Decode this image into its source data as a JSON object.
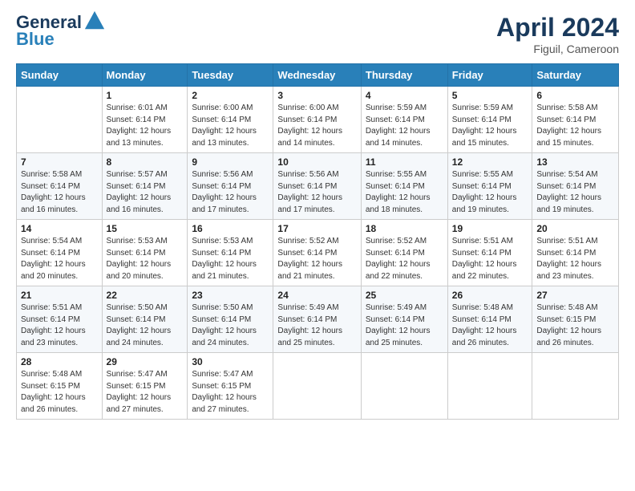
{
  "header": {
    "logo_line1": "General",
    "logo_line2": "Blue",
    "month": "April 2024",
    "location": "Figuil, Cameroon"
  },
  "weekdays": [
    "Sunday",
    "Monday",
    "Tuesday",
    "Wednesday",
    "Thursday",
    "Friday",
    "Saturday"
  ],
  "weeks": [
    [
      {
        "num": "",
        "info": ""
      },
      {
        "num": "1",
        "info": "Sunrise: 6:01 AM\nSunset: 6:14 PM\nDaylight: 12 hours\nand 13 minutes."
      },
      {
        "num": "2",
        "info": "Sunrise: 6:00 AM\nSunset: 6:14 PM\nDaylight: 12 hours\nand 13 minutes."
      },
      {
        "num": "3",
        "info": "Sunrise: 6:00 AM\nSunset: 6:14 PM\nDaylight: 12 hours\nand 14 minutes."
      },
      {
        "num": "4",
        "info": "Sunrise: 5:59 AM\nSunset: 6:14 PM\nDaylight: 12 hours\nand 14 minutes."
      },
      {
        "num": "5",
        "info": "Sunrise: 5:59 AM\nSunset: 6:14 PM\nDaylight: 12 hours\nand 15 minutes."
      },
      {
        "num": "6",
        "info": "Sunrise: 5:58 AM\nSunset: 6:14 PM\nDaylight: 12 hours\nand 15 minutes."
      }
    ],
    [
      {
        "num": "7",
        "info": "Sunrise: 5:58 AM\nSunset: 6:14 PM\nDaylight: 12 hours\nand 16 minutes."
      },
      {
        "num": "8",
        "info": "Sunrise: 5:57 AM\nSunset: 6:14 PM\nDaylight: 12 hours\nand 16 minutes."
      },
      {
        "num": "9",
        "info": "Sunrise: 5:56 AM\nSunset: 6:14 PM\nDaylight: 12 hours\nand 17 minutes."
      },
      {
        "num": "10",
        "info": "Sunrise: 5:56 AM\nSunset: 6:14 PM\nDaylight: 12 hours\nand 17 minutes."
      },
      {
        "num": "11",
        "info": "Sunrise: 5:55 AM\nSunset: 6:14 PM\nDaylight: 12 hours\nand 18 minutes."
      },
      {
        "num": "12",
        "info": "Sunrise: 5:55 AM\nSunset: 6:14 PM\nDaylight: 12 hours\nand 19 minutes."
      },
      {
        "num": "13",
        "info": "Sunrise: 5:54 AM\nSunset: 6:14 PM\nDaylight: 12 hours\nand 19 minutes."
      }
    ],
    [
      {
        "num": "14",
        "info": "Sunrise: 5:54 AM\nSunset: 6:14 PM\nDaylight: 12 hours\nand 20 minutes."
      },
      {
        "num": "15",
        "info": "Sunrise: 5:53 AM\nSunset: 6:14 PM\nDaylight: 12 hours\nand 20 minutes."
      },
      {
        "num": "16",
        "info": "Sunrise: 5:53 AM\nSunset: 6:14 PM\nDaylight: 12 hours\nand 21 minutes."
      },
      {
        "num": "17",
        "info": "Sunrise: 5:52 AM\nSunset: 6:14 PM\nDaylight: 12 hours\nand 21 minutes."
      },
      {
        "num": "18",
        "info": "Sunrise: 5:52 AM\nSunset: 6:14 PM\nDaylight: 12 hours\nand 22 minutes."
      },
      {
        "num": "19",
        "info": "Sunrise: 5:51 AM\nSunset: 6:14 PM\nDaylight: 12 hours\nand 22 minutes."
      },
      {
        "num": "20",
        "info": "Sunrise: 5:51 AM\nSunset: 6:14 PM\nDaylight: 12 hours\nand 23 minutes."
      }
    ],
    [
      {
        "num": "21",
        "info": "Sunrise: 5:51 AM\nSunset: 6:14 PM\nDaylight: 12 hours\nand 23 minutes."
      },
      {
        "num": "22",
        "info": "Sunrise: 5:50 AM\nSunset: 6:14 PM\nDaylight: 12 hours\nand 24 minutes."
      },
      {
        "num": "23",
        "info": "Sunrise: 5:50 AM\nSunset: 6:14 PM\nDaylight: 12 hours\nand 24 minutes."
      },
      {
        "num": "24",
        "info": "Sunrise: 5:49 AM\nSunset: 6:14 PM\nDaylight: 12 hours\nand 25 minutes."
      },
      {
        "num": "25",
        "info": "Sunrise: 5:49 AM\nSunset: 6:14 PM\nDaylight: 12 hours\nand 25 minutes."
      },
      {
        "num": "26",
        "info": "Sunrise: 5:48 AM\nSunset: 6:14 PM\nDaylight: 12 hours\nand 26 minutes."
      },
      {
        "num": "27",
        "info": "Sunrise: 5:48 AM\nSunset: 6:15 PM\nDaylight: 12 hours\nand 26 minutes."
      }
    ],
    [
      {
        "num": "28",
        "info": "Sunrise: 5:48 AM\nSunset: 6:15 PM\nDaylight: 12 hours\nand 26 minutes."
      },
      {
        "num": "29",
        "info": "Sunrise: 5:47 AM\nSunset: 6:15 PM\nDaylight: 12 hours\nand 27 minutes."
      },
      {
        "num": "30",
        "info": "Sunrise: 5:47 AM\nSunset: 6:15 PM\nDaylight: 12 hours\nand 27 minutes."
      },
      {
        "num": "",
        "info": ""
      },
      {
        "num": "",
        "info": ""
      },
      {
        "num": "",
        "info": ""
      },
      {
        "num": "",
        "info": ""
      }
    ]
  ]
}
